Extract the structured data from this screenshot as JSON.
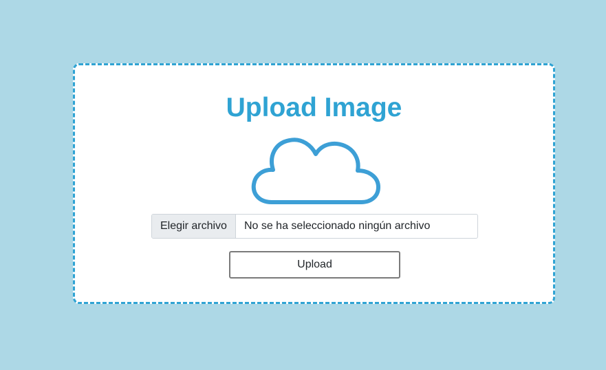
{
  "card": {
    "title": "Upload Image",
    "icon": "cloud-icon"
  },
  "file_input": {
    "button_label": "Elegir archivo",
    "status_text": "No se ha seleccionado ningún archivo"
  },
  "upload_button": {
    "label": "Upload"
  },
  "colors": {
    "background": "#add8e6",
    "accent": "#2fa3d3",
    "cloud": "#3d9fd6"
  }
}
